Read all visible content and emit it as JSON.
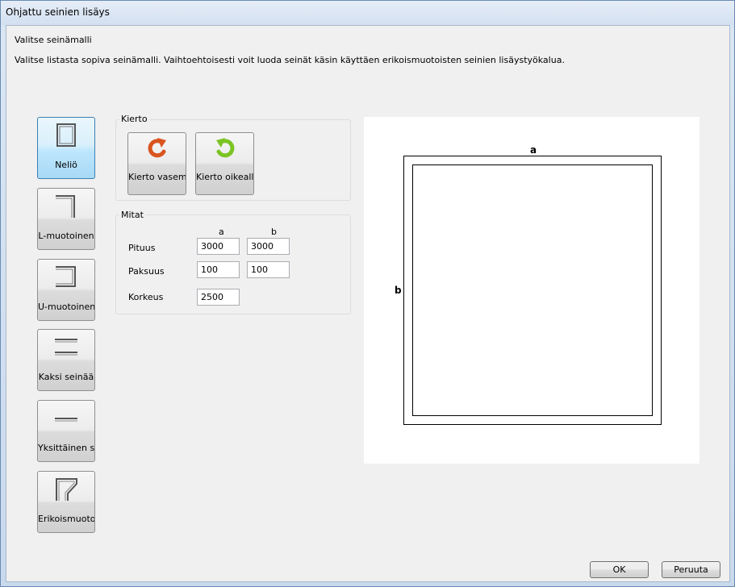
{
  "window": {
    "title": "Ohjattu seinien lisäys"
  },
  "header": {
    "title": "Valitse seinämalli",
    "description": "Valitse listasta sopiva seinämalli. Vaihtoehtoisesti voit luoda seinät käsin käyttäen erikoismuotoisten seinien lisäystyökalua."
  },
  "shapes": [
    {
      "label": "Neliö",
      "icon": "square-wall-icon",
      "selected": true
    },
    {
      "label": "L-muotoinen",
      "icon": "l-shape-wall-icon"
    },
    {
      "label": "U-muotoinen",
      "icon": "u-shape-wall-icon"
    },
    {
      "label": "Kaksi seinää",
      "icon": "two-walls-icon"
    },
    {
      "label": "Yksittäinen s...",
      "icon": "single-wall-icon"
    },
    {
      "label": "Erikoismuotoi...",
      "icon": "special-shape-wall-icon"
    }
  ],
  "rotation": {
    "title": "Kierto",
    "left_label": "Kierto vasem...",
    "right_label": "Kierto oikealle",
    "left_color": "#d9541e",
    "right_color": "#7cc424"
  },
  "dimensions": {
    "title": "Mitat",
    "col_a": "a",
    "col_b": "b",
    "length_label": "Pituus",
    "length_a": "3000",
    "length_b": "3000",
    "thickness_label": "Paksuus",
    "thickness_a": "100",
    "thickness_b": "100",
    "height_label": "Korkeus",
    "height": "2500"
  },
  "preview": {
    "label_a": "a",
    "label_b": "b"
  },
  "buttons": {
    "ok": "OK",
    "cancel": "Peruuta"
  }
}
